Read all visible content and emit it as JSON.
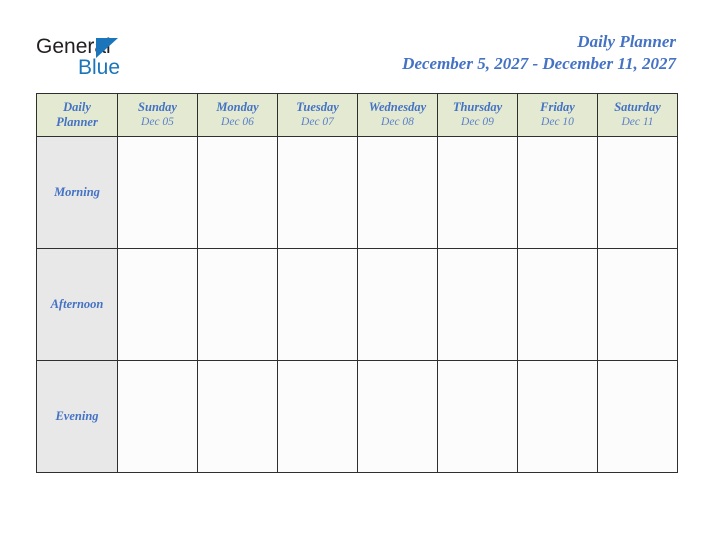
{
  "brand": {
    "name_dark": "General",
    "name_blue": "Blue",
    "triangle_color": "#1b75bb",
    "dark_color": "#231f20"
  },
  "header": {
    "title": "Daily Planner",
    "subtitle": "December 5, 2027 - December 11, 2027",
    "accent_color": "#4472c4"
  },
  "table": {
    "corner_label_line1": "Daily",
    "corner_label_line2": "Planner",
    "header_bg": "#e3ead1",
    "row_label_bg": "#e8e8e8",
    "cell_bg": "#fcfcfc",
    "border_color": "#2f2f2f",
    "columns": [
      {
        "day": "Sunday",
        "date": "Dec 05"
      },
      {
        "day": "Monday",
        "date": "Dec 06"
      },
      {
        "day": "Tuesday",
        "date": "Dec 07"
      },
      {
        "day": "Wednesday",
        "date": "Dec 08"
      },
      {
        "day": "Thursday",
        "date": "Dec 09"
      },
      {
        "day": "Friday",
        "date": "Dec 10"
      },
      {
        "day": "Saturday",
        "date": "Dec 11"
      }
    ],
    "rows": [
      {
        "label": "Morning",
        "cells": [
          "",
          "",
          "",
          "",
          "",
          "",
          ""
        ]
      },
      {
        "label": "Afternoon",
        "cells": [
          "",
          "",
          "",
          "",
          "",
          "",
          ""
        ]
      },
      {
        "label": "Evening",
        "cells": [
          "",
          "",
          "",
          "",
          "",
          "",
          ""
        ]
      }
    ]
  }
}
